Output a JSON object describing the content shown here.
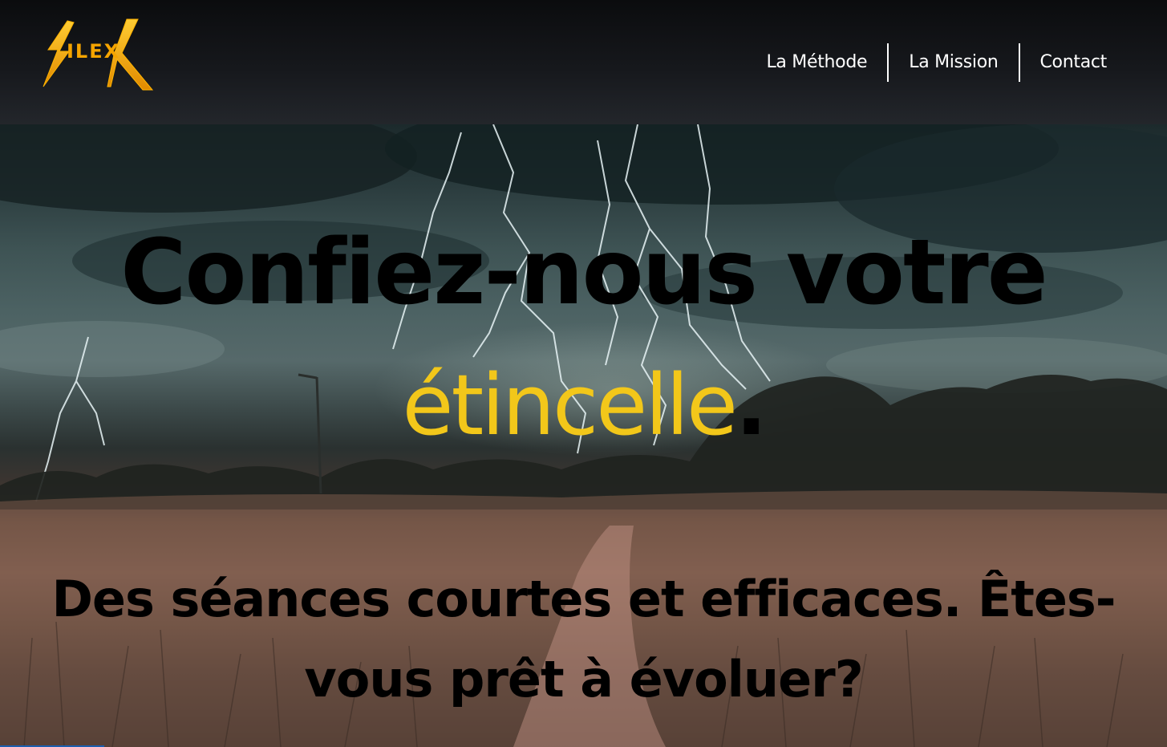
{
  "brand": {
    "logo_text": "ILEX",
    "logo_color": "#f5a400"
  },
  "nav": {
    "items": [
      {
        "label": "La Méthode"
      },
      {
        "label": "La Mission"
      },
      {
        "label": "Contact"
      }
    ]
  },
  "hero": {
    "headline": "Confiez-nous votre",
    "accent_word": "étincelle",
    "accent_punct": ".",
    "subline": "Des séances courtes et efficaces. Êtes-vous prêt à évoluer?",
    "accent_color": "#f2c71a",
    "background": "stormy field with lightning"
  }
}
